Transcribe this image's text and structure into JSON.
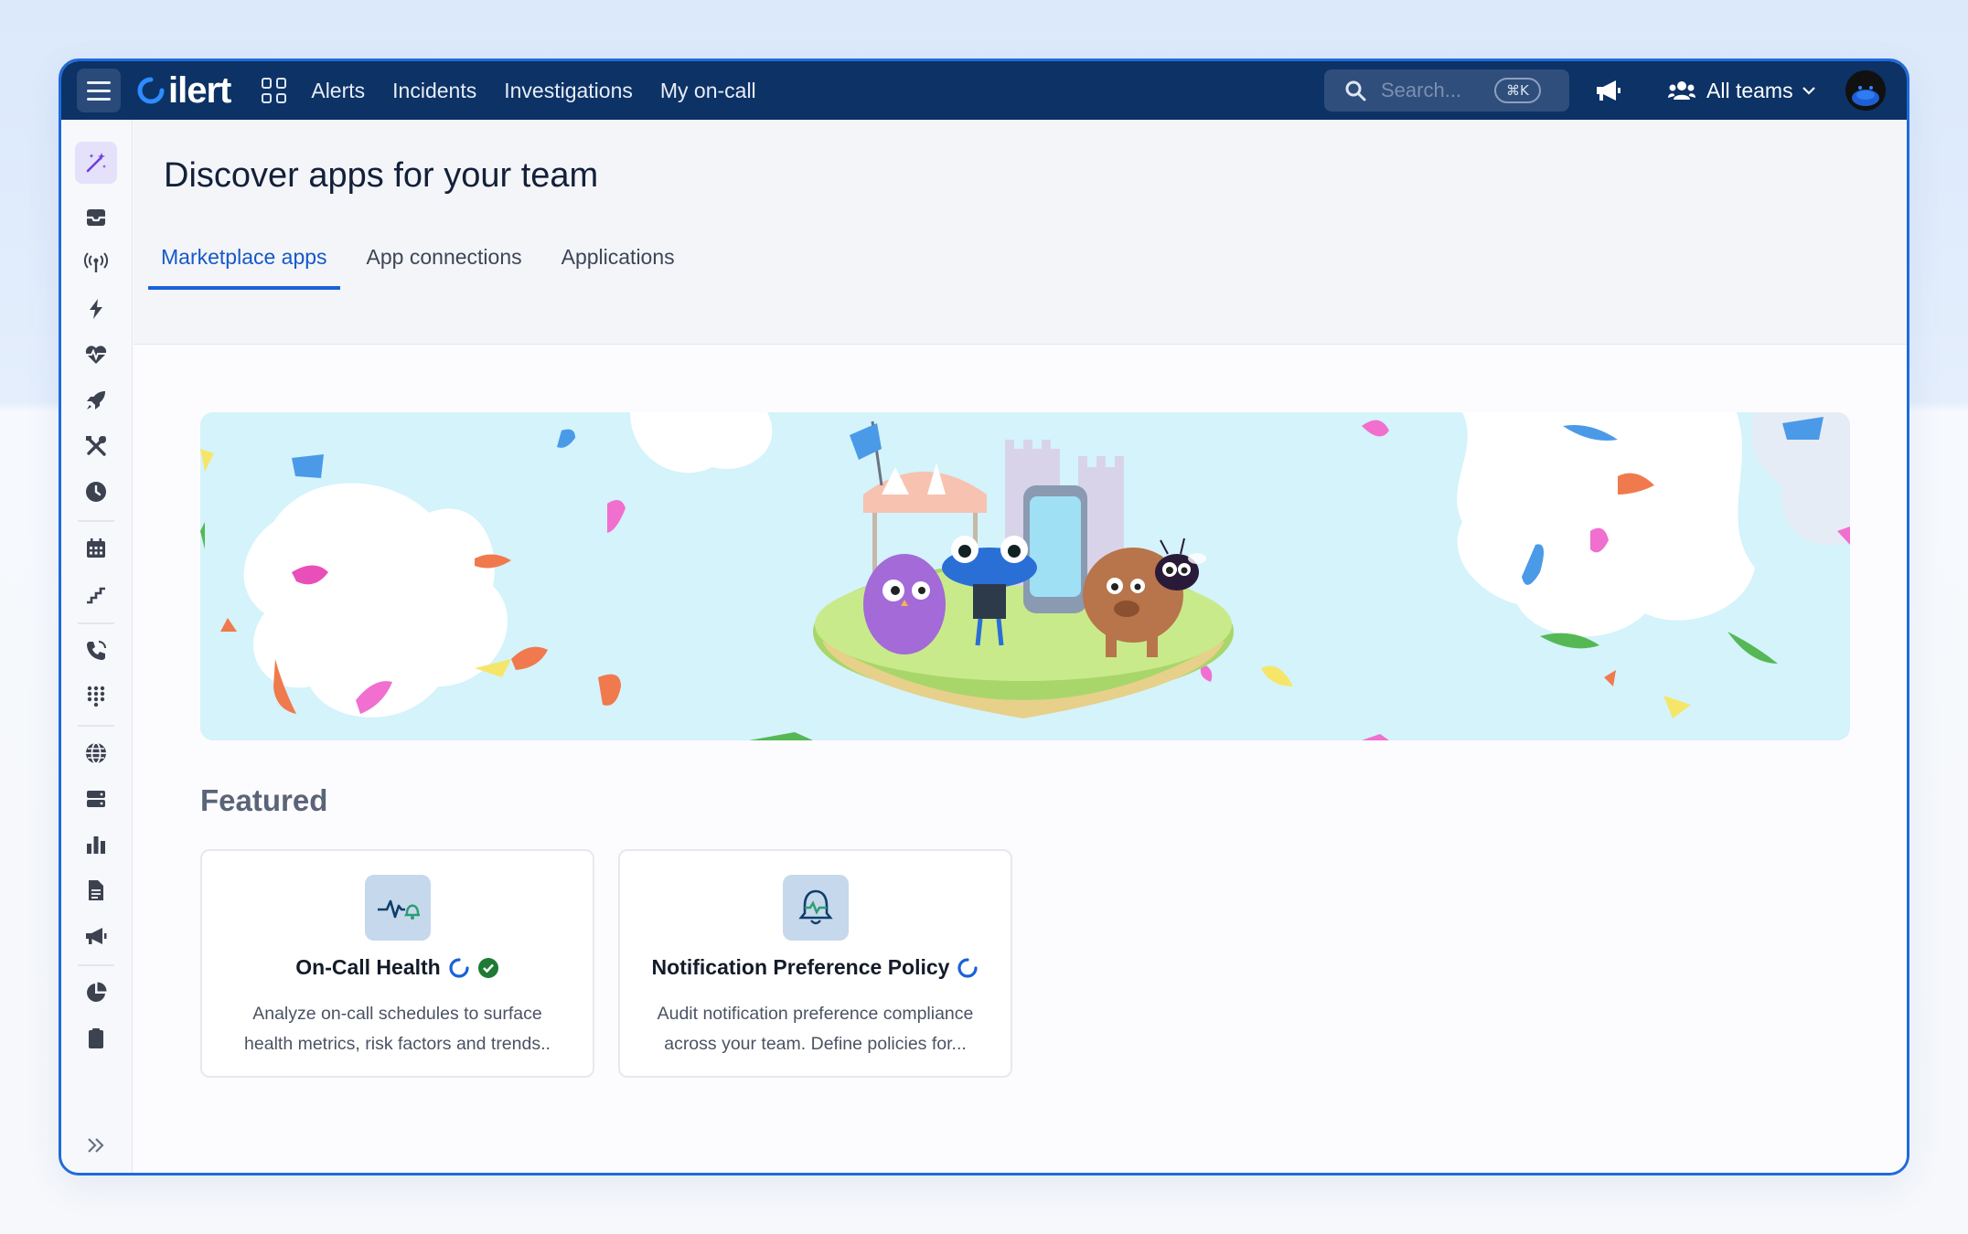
{
  "topbar": {
    "logo_text": "ilert",
    "nav": [
      "Alerts",
      "Incidents",
      "Investigations",
      "My on-call"
    ],
    "search_placeholder": "Search...",
    "search_shortcut": "⌘K",
    "teams_label": "All teams"
  },
  "sidebar": {
    "icons": [
      "magic-wand-icon",
      "inbox-icon",
      "antenna-icon",
      "lightning-icon",
      "heartbeat-icon",
      "rocket-icon",
      "tools-icon",
      "clock-icon",
      "calendar-icon",
      "escalation-icon",
      "phone-icon",
      "dialpad-icon",
      "globe-icon",
      "server-icon",
      "bar-chart-icon",
      "document-icon",
      "megaphone-icon",
      "pie-chart-icon",
      "clipboard-icon",
      "expand-icon"
    ]
  },
  "page": {
    "title": "Discover apps for your team",
    "tabs": [
      "Marketplace apps",
      "App connections",
      "Applications"
    ],
    "active_tab": "Marketplace apps",
    "featured_heading": "Featured"
  },
  "cards": [
    {
      "title": "On-Call Health",
      "description": "Analyze on-call schedules to surface health metrics, risk factors and trends..",
      "verified": true
    },
    {
      "title": "Notification Preference Policy",
      "description": "Audit notification preference compliance across your team. Define policies for...",
      "verified": false
    }
  ],
  "colors": {
    "topbar": "#0c3266",
    "accent": "#1a62d8",
    "banner_bg": "#d6f4fb",
    "verified_green": "#1e7a34"
  }
}
